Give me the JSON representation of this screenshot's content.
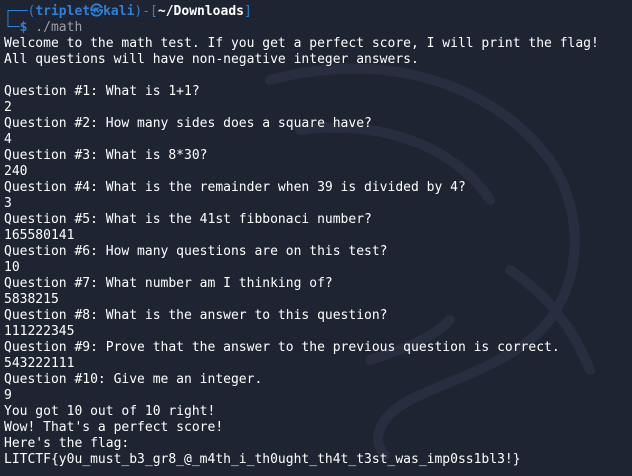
{
  "prompt": {
    "box_top_left": "┌──(",
    "user_host": "triplet㉿kali",
    "mid": ")-[",
    "path": "~/Downloads",
    "end": "]",
    "box_bottom": "└─",
    "dollar": "$",
    "command": " ./math"
  },
  "output": [
    "Welcome to the math test. If you get a perfect score, I will print the flag!",
    "All questions will have non-negative integer answers.",
    "",
    "Question #1: What is 1+1?",
    "2",
    "Question #2: How many sides does a square have?",
    "4",
    "Question #3: What is 8*30?",
    "240",
    "Question #4: What is the remainder when 39 is divided by 4?",
    "3",
    "Question #5: What is the 41st fibbonaci number?",
    "165580141",
    "Question #6: How many questions are on this test?",
    "10",
    "Question #7: What number am I thinking of?",
    "5838215",
    "Question #8: What is the answer to this question?",
    "111222345",
    "Question #9: Prove that the answer to the previous question is correct.",
    "543222111",
    "Question #10: Give me an integer.",
    "9",
    "You got 10 out of 10 right!",
    "Wow! That's a perfect score!",
    "Here's the flag:",
    "LITCTF{y0u_must_b3_gr8_@_m4th_i_th0ught_th4t_t3st_was_imp0ss1bl3!}"
  ],
  "colors": {
    "background": "#1f2433",
    "prompt_accent": "#2f7fd6",
    "text": "#ffffff",
    "command": "#9aa0aa"
  }
}
